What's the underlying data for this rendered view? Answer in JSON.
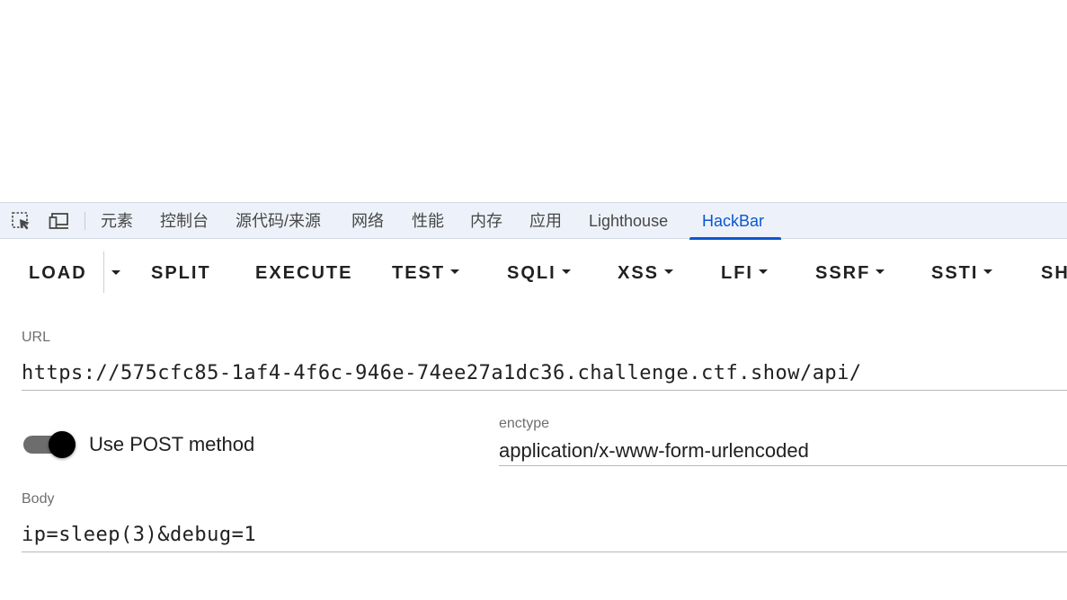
{
  "devtools": {
    "tabs": [
      {
        "label": "元素"
      },
      {
        "label": "控制台"
      },
      {
        "label": "源代码/来源"
      },
      {
        "label": "网络"
      },
      {
        "label": "性能"
      },
      {
        "label": "内存"
      },
      {
        "label": "应用"
      },
      {
        "label": "Lighthouse"
      },
      {
        "label": "HackBar",
        "active": true
      }
    ],
    "icons": [
      "inspect-element-icon",
      "device-toolbar-icon"
    ],
    "active_color": "#0b57d0",
    "bar_color": "#edf2fa"
  },
  "hackbar": {
    "toolbar": {
      "load": "LOAD",
      "split": "SPLIT",
      "execute": "EXECUTE",
      "test": "TEST",
      "sqli": "SQLI",
      "xss": "XSS",
      "lfi": "LFI",
      "ssrf": "SSRF",
      "ssti": "SSTI",
      "shell": "SH"
    },
    "url": {
      "label": "URL",
      "value": "https://575cfc85-1af4-4f6c-946e-74ee27a1dc36.challenge.ctf.show/api/"
    },
    "post": {
      "label": "Use POST method",
      "enabled": true
    },
    "enctype": {
      "label": "enctype",
      "value": "application/x-www-form-urlencoded"
    },
    "body": {
      "label": "Body",
      "value": "ip=sleep(3)&debug=1"
    }
  }
}
